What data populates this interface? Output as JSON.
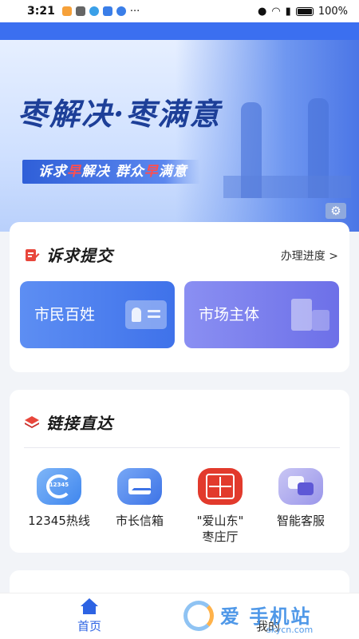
{
  "status_bar": {
    "time": "3:21",
    "more": "···",
    "battery_pct": "100%"
  },
  "banner": {
    "title": "枣解决·枣满意",
    "slogan_parts": [
      "诉求",
      "早",
      "解决  群众",
      "早",
      "满意"
    ],
    "settings_icon": "gear-icon"
  },
  "submit_section": {
    "title": "诉求提交",
    "progress_link": "办理进度 >",
    "tiles": [
      {
        "label": "市民百姓",
        "icon": "id-card-icon"
      },
      {
        "label": "市场主体",
        "icon": "building-icon"
      }
    ]
  },
  "links_section": {
    "title": "链接直达",
    "items": [
      {
        "label": "12345热线",
        "icon": "hotline-icon",
        "icon_text": "12345"
      },
      {
        "label": "市长信箱",
        "icon": "mail-icon"
      },
      {
        "label": "\"爱山东\"",
        "label2": "枣庄厅",
        "icon": "shandong-seal-icon"
      },
      {
        "label": "智能客服",
        "icon": "chat-service-icon"
      }
    ]
  },
  "bottom_nav": {
    "home": "首页",
    "mine": "我的"
  },
  "watermark": {
    "text": "爱 手机站",
    "url": "skycn.com"
  },
  "colors": {
    "primary": "#2d63e3",
    "accent_red": "#ff4e4e",
    "tile_blue": "#3f72ea",
    "tile_purple": "#6d70e8"
  }
}
